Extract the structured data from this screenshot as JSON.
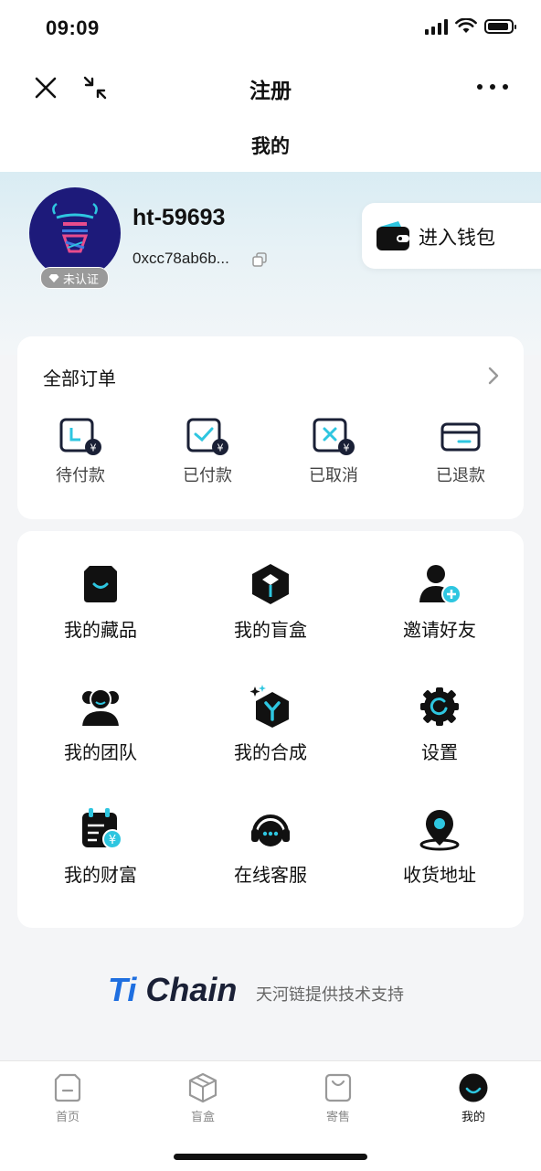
{
  "status_bar": {
    "time": "09:09"
  },
  "nav": {
    "title": "注册"
  },
  "header": {
    "title": "我的"
  },
  "profile": {
    "username": "ht-59693",
    "address": "0xcc78ab6b...",
    "badge": "未认证",
    "wallet_button": "进入钱包"
  },
  "orders": {
    "title": "全部订单",
    "items": [
      {
        "label": "待付款",
        "icon": "pending-payment-icon"
      },
      {
        "label": "已付款",
        "icon": "paid-icon"
      },
      {
        "label": "已取消",
        "icon": "cancelled-icon"
      },
      {
        "label": "已退款",
        "icon": "refunded-icon"
      }
    ]
  },
  "menu": {
    "items": [
      {
        "label": "我的藏品",
        "icon": "collection-icon"
      },
      {
        "label": "我的盲盒",
        "icon": "blind-box-icon"
      },
      {
        "label": "邀请好友",
        "icon": "invite-friend-icon"
      },
      {
        "label": "我的团队",
        "icon": "team-icon"
      },
      {
        "label": "我的合成",
        "icon": "synthesis-icon"
      },
      {
        "label": "设置",
        "icon": "settings-icon"
      },
      {
        "label": "我的财富",
        "icon": "wealth-icon"
      },
      {
        "label": "在线客服",
        "icon": "customer-service-icon"
      },
      {
        "label": "收货地址",
        "icon": "address-icon"
      }
    ]
  },
  "footer": {
    "logo_ti": "Ti",
    "logo_chain": "Chain",
    "text": "天河链提供技术支持"
  },
  "tabbar": {
    "items": [
      {
        "label": "首页",
        "icon": "home-icon"
      },
      {
        "label": "盲盒",
        "icon": "box-icon"
      },
      {
        "label": "寄售",
        "icon": "consignment-icon"
      },
      {
        "label": "我的",
        "icon": "profile-icon"
      }
    ],
    "active_index": 3
  },
  "colors": {
    "accent": "#2ec6e0",
    "brand_blue": "#1f6fe0",
    "avatar_bg": "#1d1a7a"
  }
}
